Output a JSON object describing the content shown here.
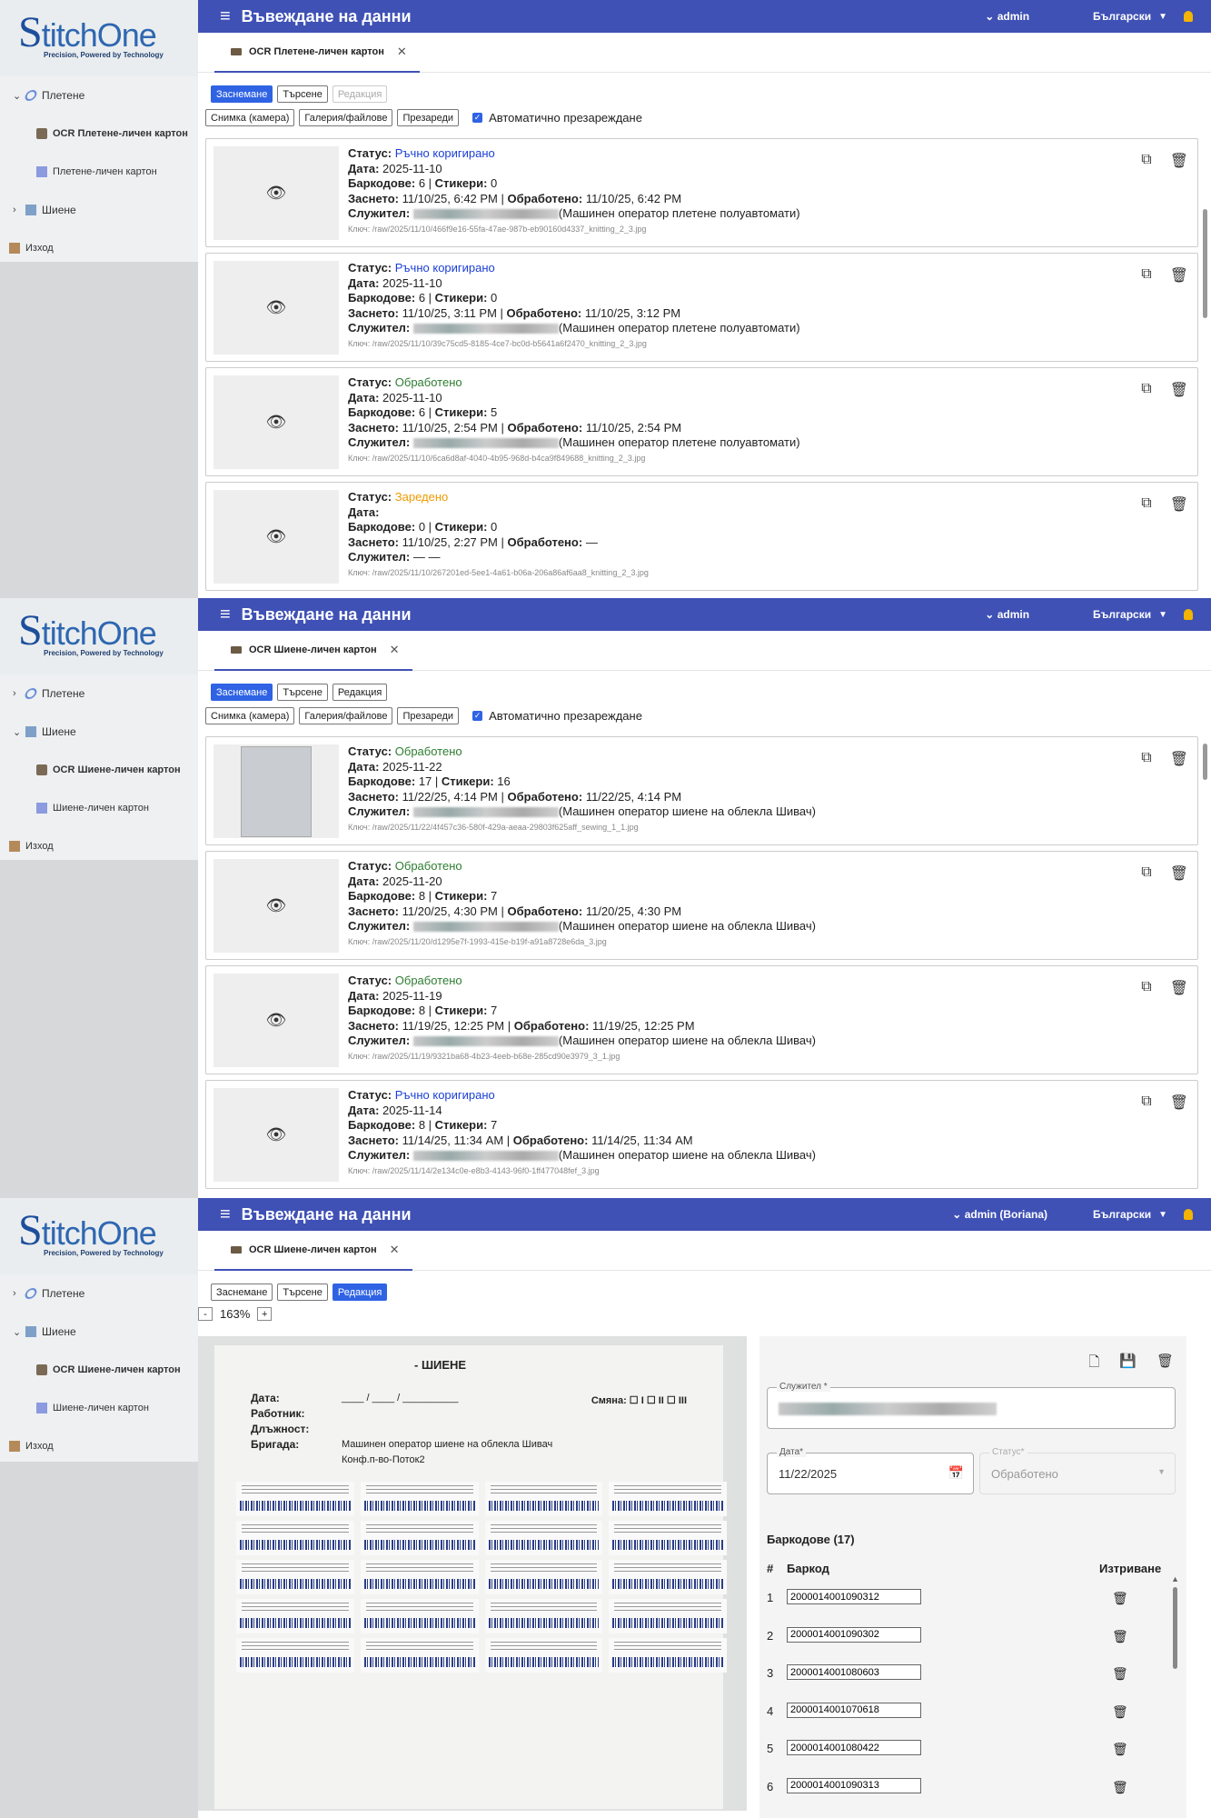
{
  "brand": {
    "logo_letter": "S",
    "logo_rest": "titchOne",
    "tagline": "Precision, Powered by Technology"
  },
  "appbar": {
    "title": "Въвеждане на данни",
    "user": "admin",
    "user_full": "admin (Boriana)",
    "lang": "Български"
  },
  "nav": {
    "knitting": "Плетене",
    "sewing": "Шиене",
    "ocr_knit": "OCR Плетене-личен картон",
    "card_knit": "Плетене-личен картон",
    "ocr_sew": "OCR Шиене-личен картон",
    "card_sew": "Шиене-личен картон",
    "exit": "Изход"
  },
  "modes": {
    "capture": "Заснемане",
    "search": "Търсене",
    "edit": "Редакция"
  },
  "sources": {
    "camera": "Снимка (камера)",
    "gallery": "Галерия/файлове",
    "reload": "Презареди",
    "auto_reload": "Автоматично презареждане"
  },
  "fields": {
    "status": "Статус:",
    "date": "Дата:",
    "barcodes": "Баркодове:",
    "stickers": "Стикери:",
    "captured": "Заснето:",
    "processed": "Обработено:",
    "employee": "Служител:",
    "key": "Ключ:"
  },
  "knit_records": [
    {
      "status": "Ръчно коригирано",
      "status_class": "st-blue",
      "date": "2025-11-10",
      "barcodes": "6",
      "stickers": "0",
      "captured": "11/10/25, 6:42 PM",
      "processed": "11/10/25, 6:42 PM",
      "role": "(Машинен оператор плетене полуавтомати)",
      "key": "/raw/2025/11/10/466f9e16-55fa-47ae-987b-eb90160d4337_knitting_2_3.jpg"
    },
    {
      "status": "Ръчно коригирано",
      "status_class": "st-blue",
      "date": "2025-11-10",
      "barcodes": "6",
      "stickers": "0",
      "captured": "11/10/25, 3:11 PM",
      "processed": "11/10/25, 3:12 PM",
      "role": "(Машинен оператор плетене полуавтомати)",
      "key": "/raw/2025/11/10/39c75cd5-8185-4ce7-bc0d-b5641a6f2470_knitting_2_3.jpg"
    },
    {
      "status": "Обработено",
      "status_class": "st-green",
      "date": "2025-11-10",
      "barcodes": "6",
      "stickers": "5",
      "captured": "11/10/25, 2:54 PM",
      "processed": "11/10/25, 2:54 PM",
      "role": "(Машинен оператор плетене полуавтомати)",
      "key": "/raw/2025/11/10/6ca6d8af-4040-4b95-968d-b4ca9f849688_knitting_2_3.jpg"
    },
    {
      "status": "Заредено",
      "status_class": "st-orange",
      "date": "",
      "barcodes": "0",
      "stickers": "0",
      "captured": "11/10/25, 2:27 PM",
      "processed": "—",
      "role": "— —",
      "key": "/raw/2025/11/10/267201ed-5ee1-4a61-b06a-206a86af6aa8_knitting_2_3.jpg"
    }
  ],
  "sew_records": [
    {
      "status": "Обработено",
      "status_class": "st-green",
      "date": "2025-11-22",
      "barcodes": "17",
      "stickers": "16",
      "captured": "11/22/25, 4:14 PM",
      "processed": "11/22/25, 4:14 PM",
      "role": "(Машинен оператор шиене на облекла Шивач)",
      "key": "/raw/2025/11/22/4f457c36-580f-429a-aeaa-29803f625aff_sewing_1_1.jpg",
      "has_thumb": true
    },
    {
      "status": "Обработено",
      "status_class": "st-green",
      "date": "2025-11-20",
      "barcodes": "8",
      "stickers": "7",
      "captured": "11/20/25, 4:30 PM",
      "processed": "11/20/25, 4:30 PM",
      "role": "(Машинен оператор шиене на облекла Шивач)",
      "key": "/raw/2025/11/20/d1295e7f-1993-415e-b19f-a91a8728e6da_3.jpg"
    },
    {
      "status": "Обработено",
      "status_class": "st-green",
      "date": "2025-11-19",
      "barcodes": "8",
      "stickers": "7",
      "captured": "11/19/25, 12:25 PM",
      "processed": "11/19/25, 12:25 PM",
      "role": "(Машинен оператор шиене на облекла Шивач)",
      "key": "/raw/2025/11/19/9321ba68-4b23-4eeb-b68e-285cd90e3979_3_1.jpg"
    },
    {
      "status": "Ръчно коригирано",
      "status_class": "st-blue",
      "date": "2025-11-14",
      "barcodes": "8",
      "stickers": "7",
      "captured": "11/14/25, 11:34 AM",
      "processed": "11/14/25, 11:34 AM",
      "role": "(Машинен оператор шиене на облекла Шивач)",
      "key": "/raw/2025/11/14/2e134c0e-e8b3-4143-96f0-1ff477048fef_3.jpg"
    }
  ],
  "editor": {
    "zoom_minus": "-",
    "zoom_plus": "+",
    "zoom": "163%",
    "scan": {
      "title": "- ШИЕНЕ",
      "date_label": "Дата:",
      "worker_label": "Работник:",
      "position_label": "Длъжност:",
      "position_value": "Машинен оператор шиене на облекла Шивач",
      "brigade_label": "Бригада:",
      "brigade_value": "Конф.п-во-Поток2",
      "shift": "Смяна: ☐ I ☐ II ☐ III",
      "date_blank": "____ / ____ / __________"
    },
    "employee_label": "Служител *",
    "date_label": "Дата*",
    "date_value": "11/22/2025",
    "status_label": "Статус*",
    "status_value": "Обработено",
    "barcodes_title": "Баркодове (17)",
    "col_num": "#",
    "col_barcode": "Баркод",
    "col_delete": "Изтриване",
    "barcodes": [
      "2000014001090312",
      "2000014001090302",
      "2000014001080603",
      "2000014001070618",
      "2000014001080422",
      "2000014001090313"
    ]
  }
}
